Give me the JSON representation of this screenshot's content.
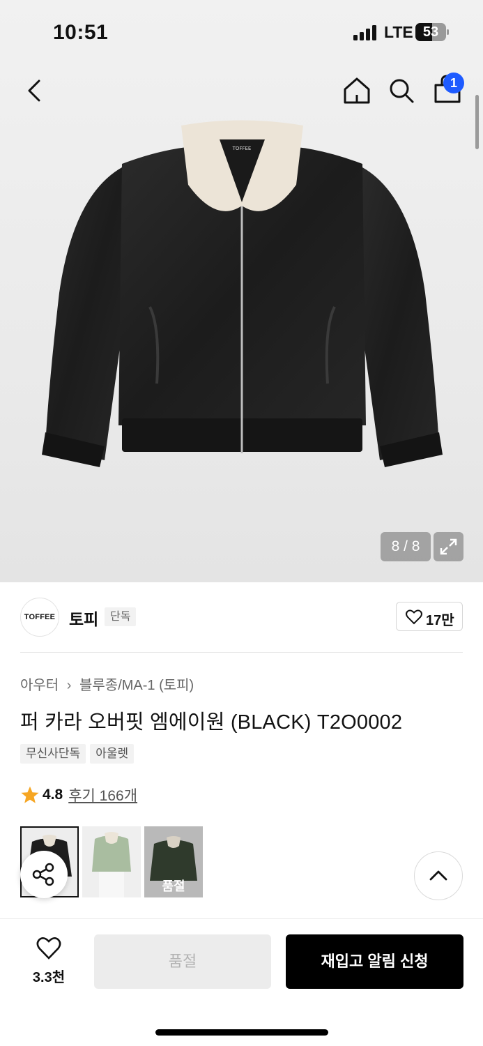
{
  "status_bar": {
    "time": "10:51",
    "network": "LTE",
    "battery": "53"
  },
  "header": {
    "cart_count": "1",
    "icons": [
      "back-icon",
      "home-icon",
      "search-icon",
      "bag-icon"
    ]
  },
  "gallery": {
    "counter": "8 / 8"
  },
  "brand": {
    "logo_text": "TOFFEE",
    "name": "토피",
    "badge": "단독",
    "likes": "17만"
  },
  "product": {
    "breadcrumb": [
      "아우터",
      "블루종/MA-1 (토피)"
    ],
    "title": "퍼 카라 오버핏 엠에이원 (BLACK) T2O0002",
    "tags": [
      "무신사단독",
      "아울렛"
    ],
    "rating": "4.8",
    "reviews_label": "후기 166개",
    "rating_star_color": "#f6a623"
  },
  "variants": [
    {
      "color": "black",
      "selected": true
    },
    {
      "color": "sage green",
      "selected": false
    },
    {
      "color": "khaki",
      "selected": false,
      "label": "품절"
    }
  ],
  "bottom_bar": {
    "wish_count": "3.3천",
    "soldout_label": "품절",
    "restock_label": "재입고 알림 신청"
  },
  "colors": {
    "accent_badge": "#1e5bff",
    "primary_button": "#000000"
  }
}
